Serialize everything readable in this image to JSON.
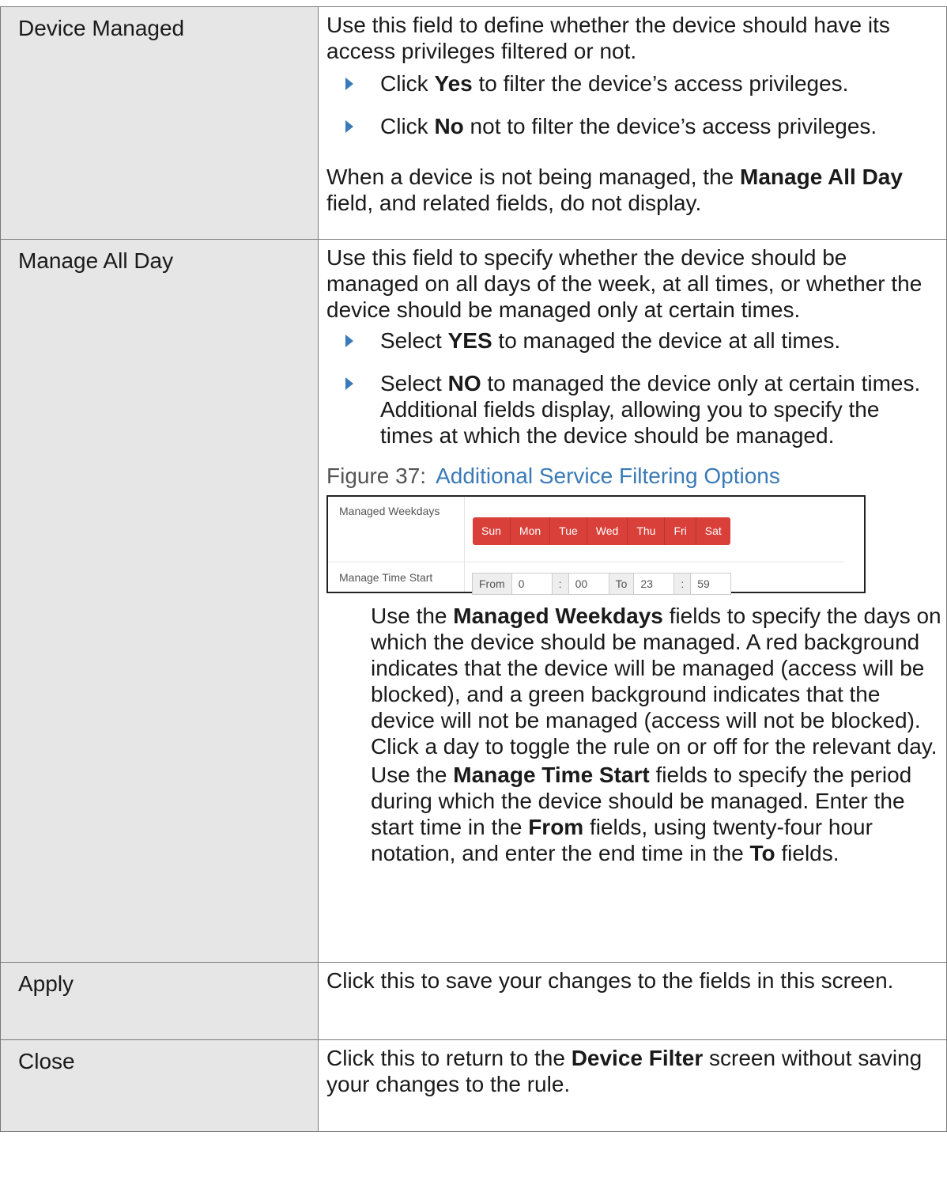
{
  "rows": [
    {
      "label": "Device Managed",
      "intro": "Use this field to define whether the device should have its access privileges filtered or not.",
      "bullets": [
        {
          "pre": "Click ",
          "bold": "Yes",
          "post": " to filter the device’s access privileges."
        },
        {
          "pre": "Click ",
          "bold": "No",
          "post": " not to filter the device’s access privileges."
        }
      ],
      "note": {
        "pre": "When a device is not being managed, the ",
        "bold": "Manage All Day",
        "post": " field, and related fields, do not display."
      }
    },
    {
      "label": "Manage All Day",
      "intro": "Use this field to specify whether the device should be managed on all days of the week, at all times, or whether the device should be managed only at certain times.",
      "bullets": [
        {
          "pre": "Select ",
          "bold": "YES",
          "post": " to managed the device at all times."
        },
        {
          "pre": "Select ",
          "bold": "NO",
          "post": " to managed the device only at certain times. Additional fields display, allowing you to specify the times at which the device should be managed."
        }
      ],
      "figure": {
        "number": "Figure 37:",
        "title": "Additional Service Filtering Options",
        "weekdays_label": "Managed Weekdays",
        "days": [
          "Sun",
          "Mon",
          "Tue",
          "Wed",
          "Thu",
          "Fri",
          "Sat"
        ],
        "time_label": "Manage Time Start",
        "from_label": "From",
        "from_hour": "0",
        "sep1": ":",
        "from_min": "00",
        "to_label": "To",
        "to_hour": "23",
        "sep2": ":",
        "to_min": "59",
        "day_color": "#d9403a"
      },
      "para1": {
        "pre": "Use the ",
        "bold": "Managed Weekdays",
        "post": " fields to specify the days on which the device should be managed. A red background indicates that the device will be managed (access will be blocked), and a green background indicates that the device will not be managed (access will not be blocked). Click a day to toggle the rule on or off for the relevant day."
      },
      "para2": {
        "pre": "Use the ",
        "bold1": "Manage Time Start",
        "mid1": " fields to specify the period during which the device should be managed. Enter the start time in the ",
        "bold2": "From",
        "mid2": " fields, using twenty-four hour notation, and enter the end time in the ",
        "bold3": "To",
        "post": " fields."
      }
    },
    {
      "label": "Apply",
      "desc": "Click this to save your changes to the fields in this screen."
    },
    {
      "label": "Close",
      "desc_pre": "Click this to return to the ",
      "desc_bold": "Device Filter",
      "desc_post": " screen without saving your changes to the rule."
    }
  ]
}
